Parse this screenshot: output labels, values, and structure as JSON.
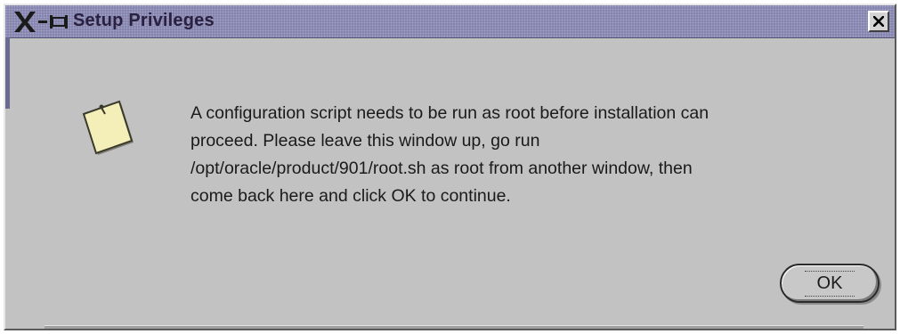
{
  "window": {
    "title": "Setup Privileges",
    "close_label": "×"
  },
  "message": {
    "lines": [
      "A configuration script needs to be run as root before installation can",
      "proceed. Please leave this window up, go run",
      "/opt/oracle/product/901/root.sh as root from another window, then",
      "come back here and click OK to continue."
    ]
  },
  "buttons": {
    "ok_label": "OK"
  },
  "icons": {
    "window_menu": "x-window-menu-icon",
    "message": "note-icon",
    "close": "close-icon"
  },
  "colors": {
    "titlebar": "#7e7ea8",
    "dialog_background": "#c2c2c2",
    "note_paper": "#f4efb8"
  }
}
